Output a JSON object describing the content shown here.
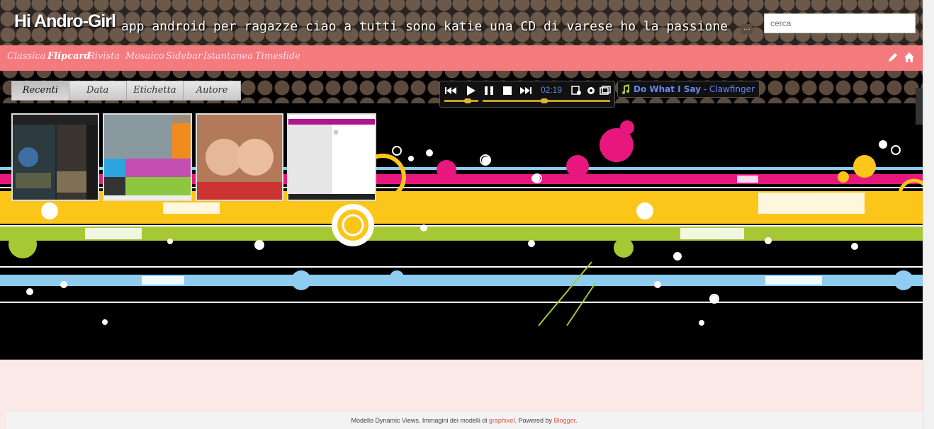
{
  "header": {
    "title": "Hi Andro-Girl",
    "description": "app android per ragazze ciao a tutti sono katie una CD di varese ho la passione",
    "search_placeholder": "cerca"
  },
  "navbar": {
    "items": [
      {
        "label": "Classica"
      },
      {
        "label": "Flipcard",
        "active": true
      },
      {
        "label": "Rivista"
      },
      {
        "label": "Mosaico"
      },
      {
        "label": "Sidebar"
      },
      {
        "label": "Istantanea"
      },
      {
        "label": "Timeslide"
      }
    ],
    "icons": [
      "pencil-icon",
      "home-icon"
    ]
  },
  "subtabs": [
    {
      "label": "Recenti",
      "active": true
    },
    {
      "label": "Data"
    },
    {
      "label": "Etichetta"
    },
    {
      "label": "Autore"
    }
  ],
  "player": {
    "time": "02:19",
    "song_title": "Do What I Say",
    "separator": " - ",
    "artist": "Clawfinger"
  },
  "footer": {
    "prefix": "Modello Dynamic Views. Immagini dei modelli di ",
    "link1": "graphixel",
    "middle": ". Powered by ",
    "link2": "Blogger",
    "suffix": "."
  },
  "colors": {
    "nav_bg": "#f47a7e",
    "page_bg": "#fbe9e7",
    "stripe_yellow": "#fcc51a",
    "stripe_pink": "#e8177d",
    "stripe_green": "#a6c834",
    "stripe_blue": "#8fcdf0"
  }
}
